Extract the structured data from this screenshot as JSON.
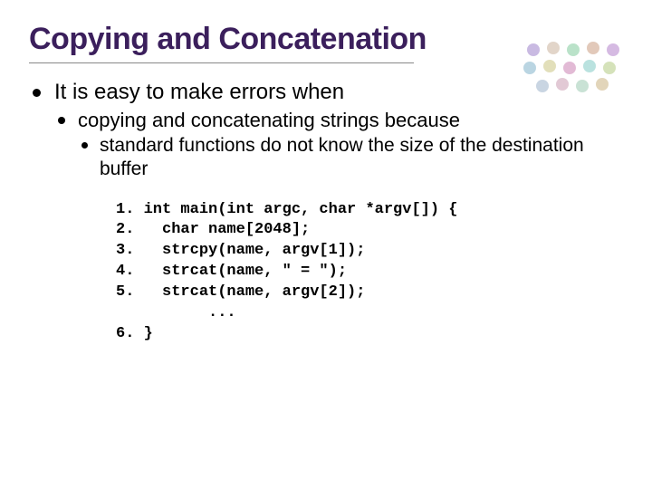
{
  "title": "Copying and Concatenation",
  "bullets": {
    "l1": "It is easy to make errors when",
    "l2": "copying and concatenating strings because",
    "l3": "standard functions do not know the size of the destination buffer"
  },
  "code": "1. int main(int argc, char *argv[]) {\n2.   char name[2048];\n3.   strcpy(name, argv[1]);\n4.   strcat(name, \" = \");\n5.   strcat(name, argv[2]);\n          ...\n6. }"
}
